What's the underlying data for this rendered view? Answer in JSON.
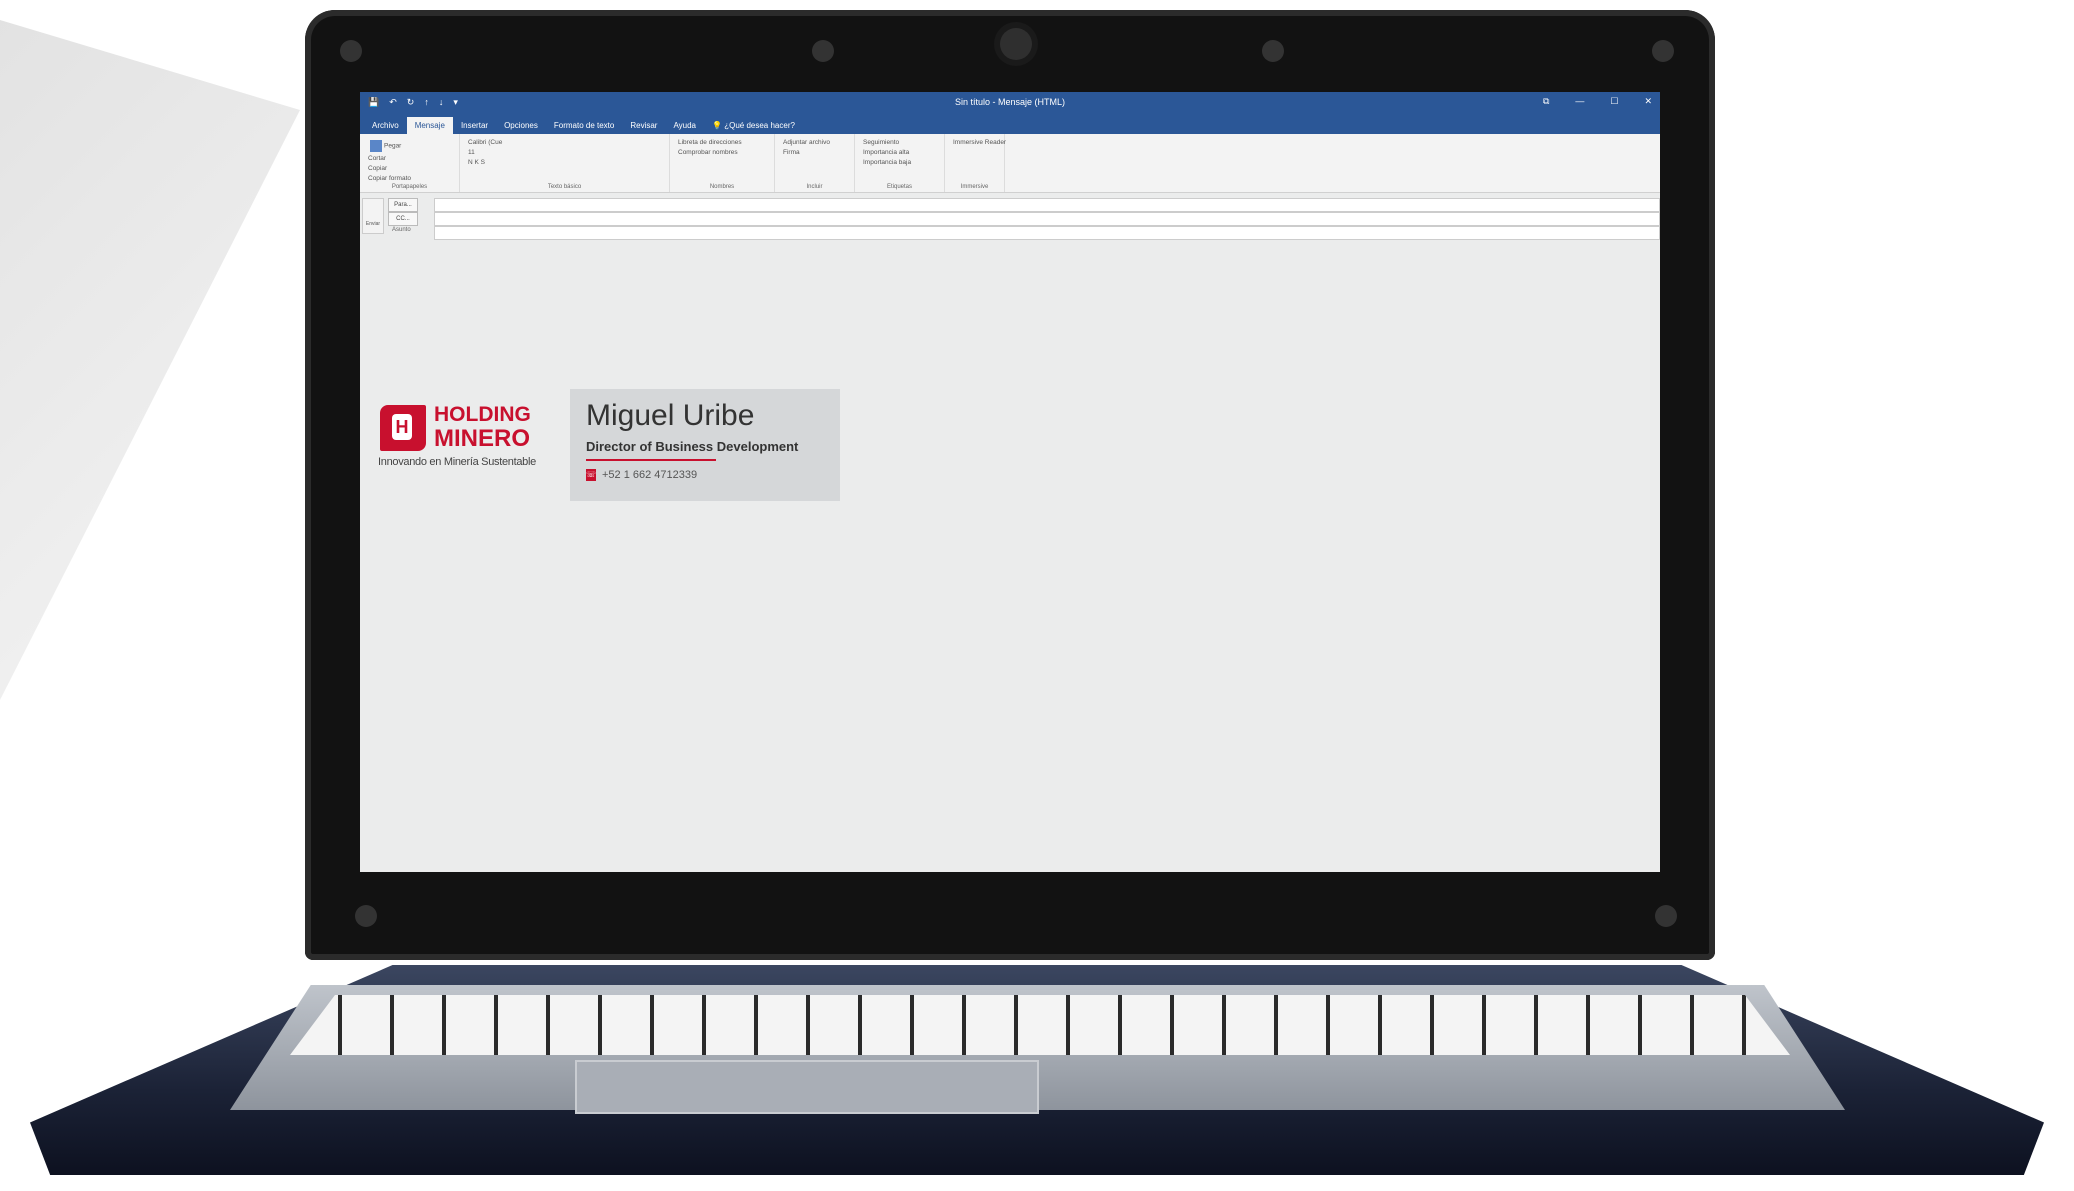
{
  "window": {
    "title": "Sin título - Mensaje (HTML)",
    "controls": [
      "⧉",
      "—",
      "☐",
      "✕"
    ]
  },
  "quick_access": [
    "💾",
    "↶",
    "↻",
    "↑",
    "↓",
    "▾"
  ],
  "tabs": [
    "Archivo",
    "Mensaje",
    "Insertar",
    "Opciones",
    "Formato de texto",
    "Revisar",
    "Ayuda"
  ],
  "active_tab": "Mensaje",
  "tell_me": "¿Qué desea hacer?",
  "ribbon": {
    "portapapeles": {
      "label": "Portapapeles",
      "paste": "Pegar",
      "cut": "Cortar",
      "copy": "Copiar",
      "format_painter": "Copiar formato"
    },
    "texto_basico": {
      "label": "Texto básico",
      "font": "Calibri (Cue",
      "size": "11"
    },
    "nombres": {
      "label": "Nombres",
      "address_book": "Libreta de direcciones",
      "check_names": "Comprobar nombres"
    },
    "incluir": {
      "label": "Incluir",
      "attach": "Adjuntar archivo",
      "signature": "Firma"
    },
    "etiquetas": {
      "label": "Etiquetas",
      "followup": "Seguimiento",
      "high": "Importancia alta",
      "low": "Importancia baja"
    },
    "immersive": {
      "label": "Immersive",
      "reader": "Immersive Reader"
    }
  },
  "compose": {
    "send": "Enviar",
    "to": "Para...",
    "cc": "CC...",
    "subject": "Asunto"
  },
  "signature": {
    "company_line1": "HOLDING",
    "company_line2": "MINERO",
    "logo_letter": "H",
    "tagline": "Innovando en Minería Sustentable",
    "name": "Miguel Uribe",
    "title": "Director of Business Development",
    "phone": "+52 1 662 4712339"
  },
  "colors": {
    "brand_red": "#c8102e",
    "outlook_blue": "#2b5797"
  }
}
